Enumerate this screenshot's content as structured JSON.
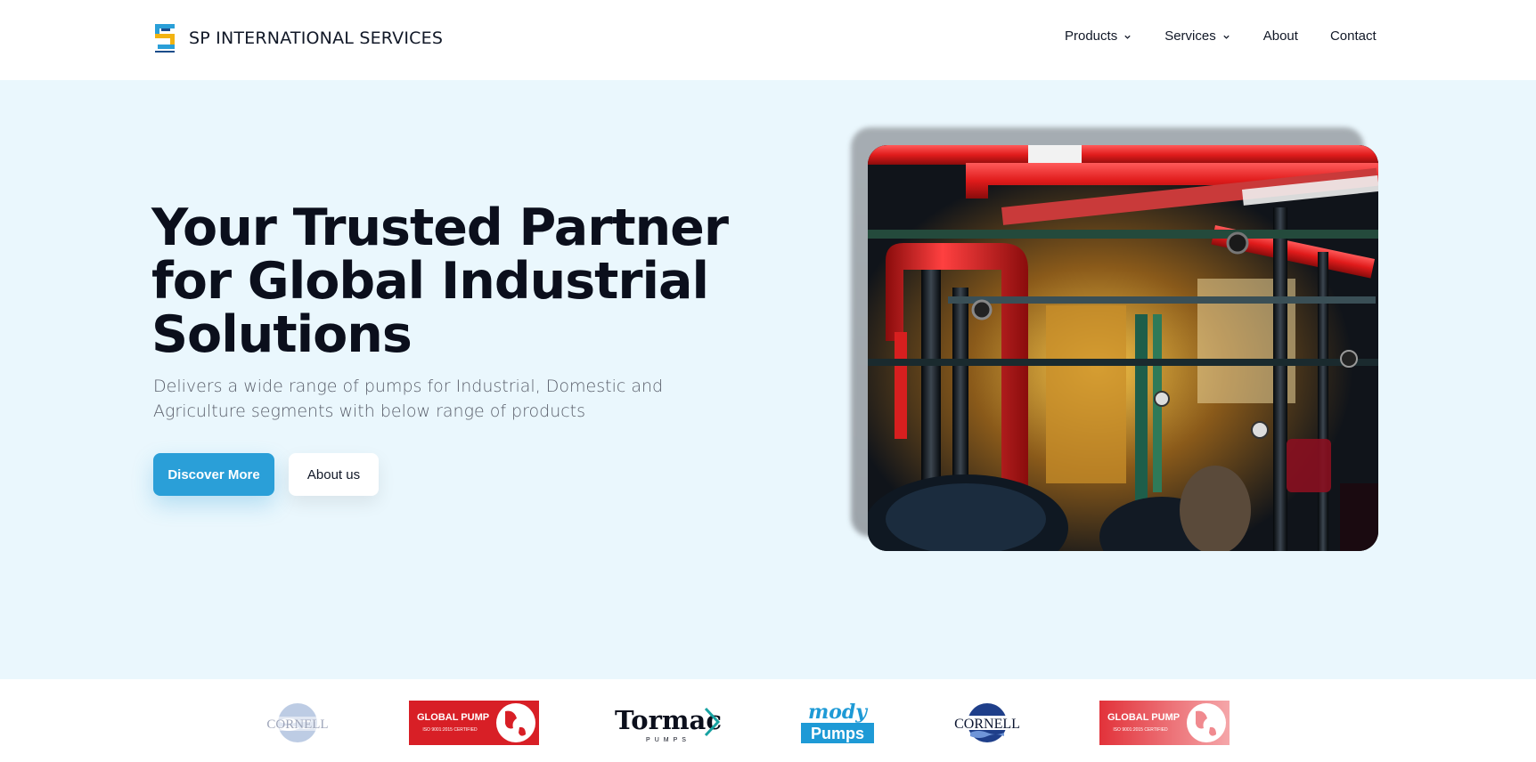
{
  "header": {
    "brand": "SP INTERNATIONAL SERVICES",
    "logo_icon": "sp-logo-icon",
    "nav": [
      {
        "label": "Products",
        "has_dropdown": true
      },
      {
        "label": "Services",
        "has_dropdown": true
      },
      {
        "label": "About",
        "has_dropdown": false
      },
      {
        "label": "Contact",
        "has_dropdown": false
      }
    ]
  },
  "hero": {
    "headline": "Your Trusted Partner for Global Industrial Solutions",
    "subtext": "Delivers a wide range of pumps for Industrial, Domestic and Agriculture segments with below range of products",
    "primary_button": "Discover More",
    "secondary_button": "About us",
    "image_subject": "industrial-pipes-image"
  },
  "partners": {
    "logos": [
      {
        "name": "cornell-logo-faded",
        "text": "CORNELL"
      },
      {
        "name": "global-pump-logo",
        "text": "GLOBAL PUMP",
        "subtext": "ISO 9001:2015 CERTIFIED"
      },
      {
        "name": "tormac-logo",
        "text": "Tormac",
        "subtext": "PUMPS"
      },
      {
        "name": "mody-pumps-logo",
        "text": "mody",
        "subtext": "Pumps"
      },
      {
        "name": "cornell-logo",
        "text": "CORNELL"
      },
      {
        "name": "global-pump-logo-faded",
        "text": "GLOBAL PUMP",
        "subtext": "ISO 9001:2015 CERTIFIED"
      }
    ]
  },
  "colors": {
    "accent": "#2a9fd8",
    "hero_bg": "#eaf7fd",
    "heading": "#0b0f1c",
    "body_text": "#5a5f6b",
    "global_pump_red": "#d81f26",
    "cornell_blue": "#1f3f8a"
  }
}
